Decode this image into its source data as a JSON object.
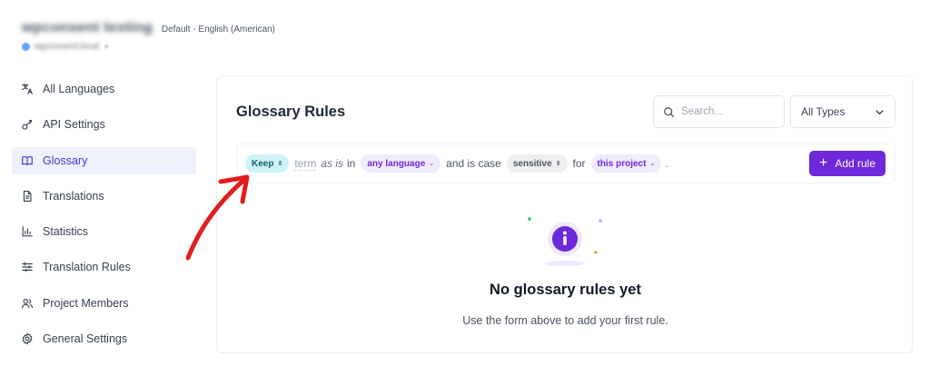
{
  "header": {
    "site_name": "wpconsent testing",
    "language": "Default - English (American)",
    "domain": "wpconsent.local",
    "domain_caret": "▾"
  },
  "sidebar": {
    "items": [
      {
        "label": "All Languages",
        "icon": "translate-icon",
        "active": false
      },
      {
        "label": "API Settings",
        "icon": "key-icon",
        "active": false
      },
      {
        "label": "Glossary",
        "icon": "book-icon",
        "active": true
      },
      {
        "label": "Translations",
        "icon": "document-icon",
        "active": false
      },
      {
        "label": "Statistics",
        "icon": "bar-chart-icon",
        "active": false
      },
      {
        "label": "Translation Rules",
        "icon": "sliders-icon",
        "active": false
      },
      {
        "label": "Project Members",
        "icon": "users-icon",
        "active": false
      },
      {
        "label": "General Settings",
        "icon": "gear-icon",
        "active": false
      }
    ]
  },
  "main": {
    "title": "Glossary Rules",
    "search": {
      "placeholder": "Search...",
      "value": ""
    },
    "type_filter": {
      "selected": "All Types"
    },
    "rule": {
      "action": "Keep",
      "term_placeholder": "term",
      "as_is": "as is",
      "in_word": "in",
      "language": "any language",
      "case_phrase": "and is case",
      "case": "sensitive",
      "for_word": "for",
      "scope": "this project",
      "period": "."
    },
    "add_button": {
      "label": "Add rule",
      "icon": "plus-icon"
    },
    "empty_state": {
      "title": "No glossary rules yet",
      "subtitle": "Use the form above to add your first rule.",
      "icon": "info-icon"
    }
  },
  "colors": {
    "accent": "#6d28d9",
    "nav_active_bg": "#eef0fb",
    "keep_pill_bg": "#cdf3f7",
    "annotation_arrow": "#e11d1d"
  }
}
